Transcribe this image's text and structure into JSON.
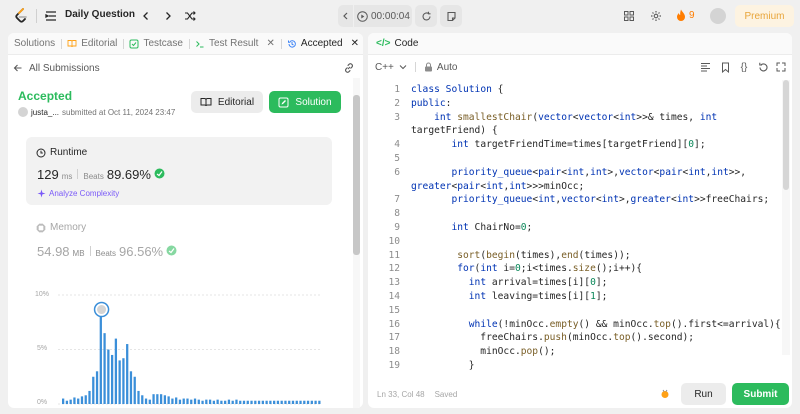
{
  "topbar": {
    "title": "Daily Question",
    "timer": "00:00:04",
    "streak_count": "9",
    "premium_label": "Premium"
  },
  "left_tabs": [
    {
      "label": "Solutions"
    },
    {
      "label": "Editorial"
    },
    {
      "label": "Testcase"
    },
    {
      "label": "Test Result"
    },
    {
      "label": "Accepted"
    }
  ],
  "submission": {
    "back_label": "All Submissions",
    "status": "Accepted",
    "author": "justa_...",
    "submitted_at": "submitted at Oct 11, 2024 23:47",
    "editorial_label": "Editorial",
    "solution_label": "Solution"
  },
  "runtime": {
    "label": "Runtime",
    "value": "129",
    "unit": "ms",
    "beats_label": "Beats",
    "beats_value": "89.69%",
    "analyze_label": "Analyze Complexity"
  },
  "memory": {
    "label": "Memory",
    "value": "54.98",
    "unit": "MB",
    "beats_label": "Beats",
    "beats_value": "96.56%"
  },
  "chart_data": {
    "type": "bar",
    "y_ticks": [
      "10%",
      "5%",
      "0%"
    ],
    "ylim": [
      0,
      10
    ],
    "highlight_index": 10,
    "values": [
      0.5,
      0.3,
      0.4,
      0.6,
      0.5,
      0.7,
      0.8,
      1.2,
      2.5,
      3.0,
      8.3,
      6.5,
      5.0,
      4.5,
      6.0,
      4.0,
      4.2,
      5.5,
      3.0,
      2.5,
      1.2,
      0.8,
      0.5,
      0.4,
      0.9,
      0.9,
      0.9,
      0.8,
      0.7,
      0.5,
      0.6,
      0.4,
      0.5,
      0.5,
      0.4,
      0.5,
      0.4,
      0.3,
      0.4,
      0.4,
      0.3,
      0.4,
      0.3,
      0.3,
      0.4,
      0.3,
      0.4,
      0.3,
      0.3,
      0.3,
      0.3,
      0.3,
      0.3,
      0.3,
      0.3,
      0.3,
      0.3,
      0.3,
      0.3,
      0.3,
      0.3,
      0.3,
      0.3,
      0.3,
      0.3,
      0.3,
      0.3,
      0.3,
      0.3
    ]
  },
  "code_panel": {
    "tab_label": "Code",
    "language": "C++",
    "auto_label": "Auto",
    "status_position": "Ln 33, Col 48",
    "status_saved": "Saved",
    "run_label": "Run",
    "submit_label": "Submit",
    "lines": [
      {
        "n": "1",
        "text": "class Solution {"
      },
      {
        "n": "2",
        "text": "public:"
      },
      {
        "n": "3",
        "text": "    int smallestChair(vector<vector<int>>& times, int"
      },
      {
        "n": "",
        "text": "targetFriend) {"
      },
      {
        "n": "4",
        "text": "       int targetFriendTime=times[targetFriend][0];"
      },
      {
        "n": "5",
        "text": ""
      },
      {
        "n": "6",
        "text": "       priority_queue<pair<int,int>,vector<pair<int,int>>,"
      },
      {
        "n": "",
        "text": "greater<pair<int,int>>>minOcc;"
      },
      {
        "n": "7",
        "text": "       priority_queue<int,vector<int>,greater<int>>freeChairs;"
      },
      {
        "n": "8",
        "text": ""
      },
      {
        "n": "9",
        "text": "       int ChairNo=0;"
      },
      {
        "n": "10",
        "text": ""
      },
      {
        "n": "11",
        "text": "        sort(begin(times),end(times));"
      },
      {
        "n": "12",
        "text": "        for(int i=0;i<times.size();i++){"
      },
      {
        "n": "13",
        "text": "          int arrival=times[i][0];"
      },
      {
        "n": "14",
        "text": "          int leaving=times[i][1];"
      },
      {
        "n": "15",
        "text": ""
      },
      {
        "n": "16",
        "text": "          while(!minOcc.empty() && minOcc.top().first<=arrival){"
      },
      {
        "n": "17",
        "text": "            freeChairs.push(minOcc.top().second);"
      },
      {
        "n": "18",
        "text": "            minOcc.pop();"
      },
      {
        "n": "19",
        "text": "          }"
      }
    ]
  }
}
